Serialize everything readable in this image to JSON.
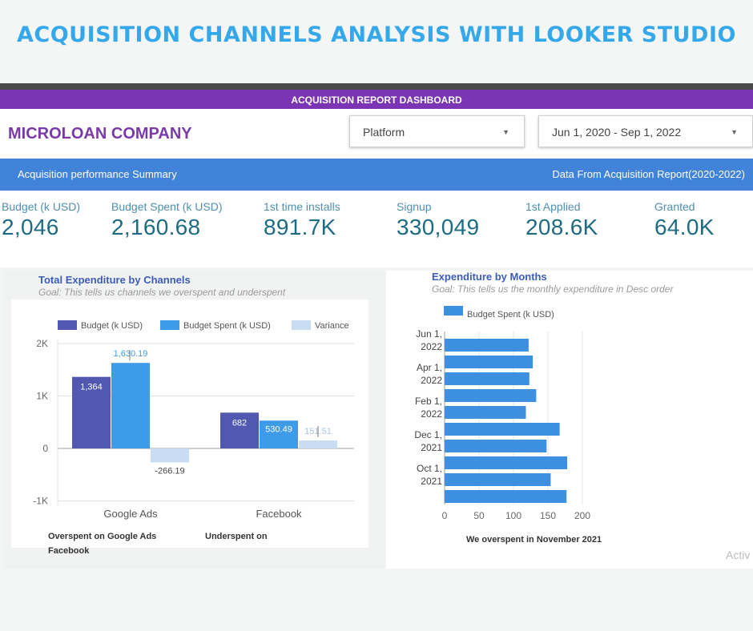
{
  "banner": {
    "title": "ACQUISITION CHANNELS ANALYSIS WITH LOOKER STUDIO"
  },
  "dashboard": {
    "header": "ACQUISITION REPORT DASHBOARD",
    "company": "MICROLOAN COMPANY",
    "platform_select": "Platform",
    "date_select": "Jun 1, 2020 - Sep 1, 2022",
    "summary_left": "Acquisition performance Summary",
    "summary_right": "Data From Acquisition Report(2020-2022)"
  },
  "kpis": [
    {
      "label": "Budget (k USD)",
      "value": "2,046"
    },
    {
      "label": "Budget Spent (k USD)",
      "value": "2,160.68"
    },
    {
      "label": "1st time installs",
      "value": "891.7K"
    },
    {
      "label": "Signup",
      "value": "330,049"
    },
    {
      "label": "1st Applied",
      "value": "208.6K"
    },
    {
      "label": "Granted",
      "value": "64.0K"
    }
  ],
  "left_panel": {
    "title": "Total Expenditure by Channels",
    "subtitle": "Goal: This tells us channels we overspent and underspent",
    "note1": "Overspent on Google Ads",
    "note2": "Underspent on",
    "note3": "Facebook"
  },
  "right_panel": {
    "title": "Expenditure by Months",
    "subtitle": "Goal: This tells us the monthly expenditure in Desc order",
    "note": "We overspent in November 2021"
  },
  "watermark": "Activ",
  "colors": {
    "budget": "#5058b0",
    "budget_spent": "#3d9be9",
    "variance": "#c8dcf2",
    "bar_month": "#3d8fe0",
    "purple": "#7b34b3",
    "blue_bar": "#4183d8"
  },
  "chart_data": [
    {
      "type": "bar",
      "categories": [
        "Google Ads",
        "Facebook"
      ],
      "series": [
        {
          "name": "Budget (k USD)",
          "values": [
            1364,
            682
          ],
          "labels": [
            "1,364",
            "682"
          ]
        },
        {
          "name": "Budget Spent (k USD)",
          "values": [
            1630.19,
            530.49
          ],
          "labels": [
            "1,630.19",
            "530.49"
          ]
        },
        {
          "name": "Variance",
          "values": [
            -266.19,
            151.51
          ],
          "labels": [
            "-266.19",
            "151.51"
          ]
        }
      ],
      "yticks": [
        {
          "v": 2000,
          "label": "2K"
        },
        {
          "v": 1000,
          "label": "1K"
        },
        {
          "v": 0,
          "label": "0"
        },
        {
          "v": -1000,
          "label": "-1K"
        }
      ],
      "ylim": [
        -1000,
        2000
      ],
      "legend": "top-right"
    },
    {
      "type": "bar",
      "orientation": "horizontal",
      "series": [
        {
          "name": "Budget Spent (k USD)",
          "values": [
            122,
            128,
            123,
            133,
            118,
            167,
            148,
            178,
            154,
            177
          ]
        }
      ],
      "category_labels": [
        {
          "i": 0,
          "line1": "Jun 1,",
          "line2": "2022"
        },
        {
          "i": 2,
          "line1": "Apr 1,",
          "line2": "2022"
        },
        {
          "i": 4,
          "line1": "Feb 1,",
          "line2": "2022"
        },
        {
          "i": 6,
          "line1": "Dec 1,",
          "line2": "2021"
        },
        {
          "i": 8,
          "line1": "Oct 1,",
          "line2": "2021"
        }
      ],
      "xticks": [
        0,
        50,
        100,
        150,
        200
      ],
      "xlim": [
        0,
        210
      ],
      "legend": "top-left"
    }
  ]
}
